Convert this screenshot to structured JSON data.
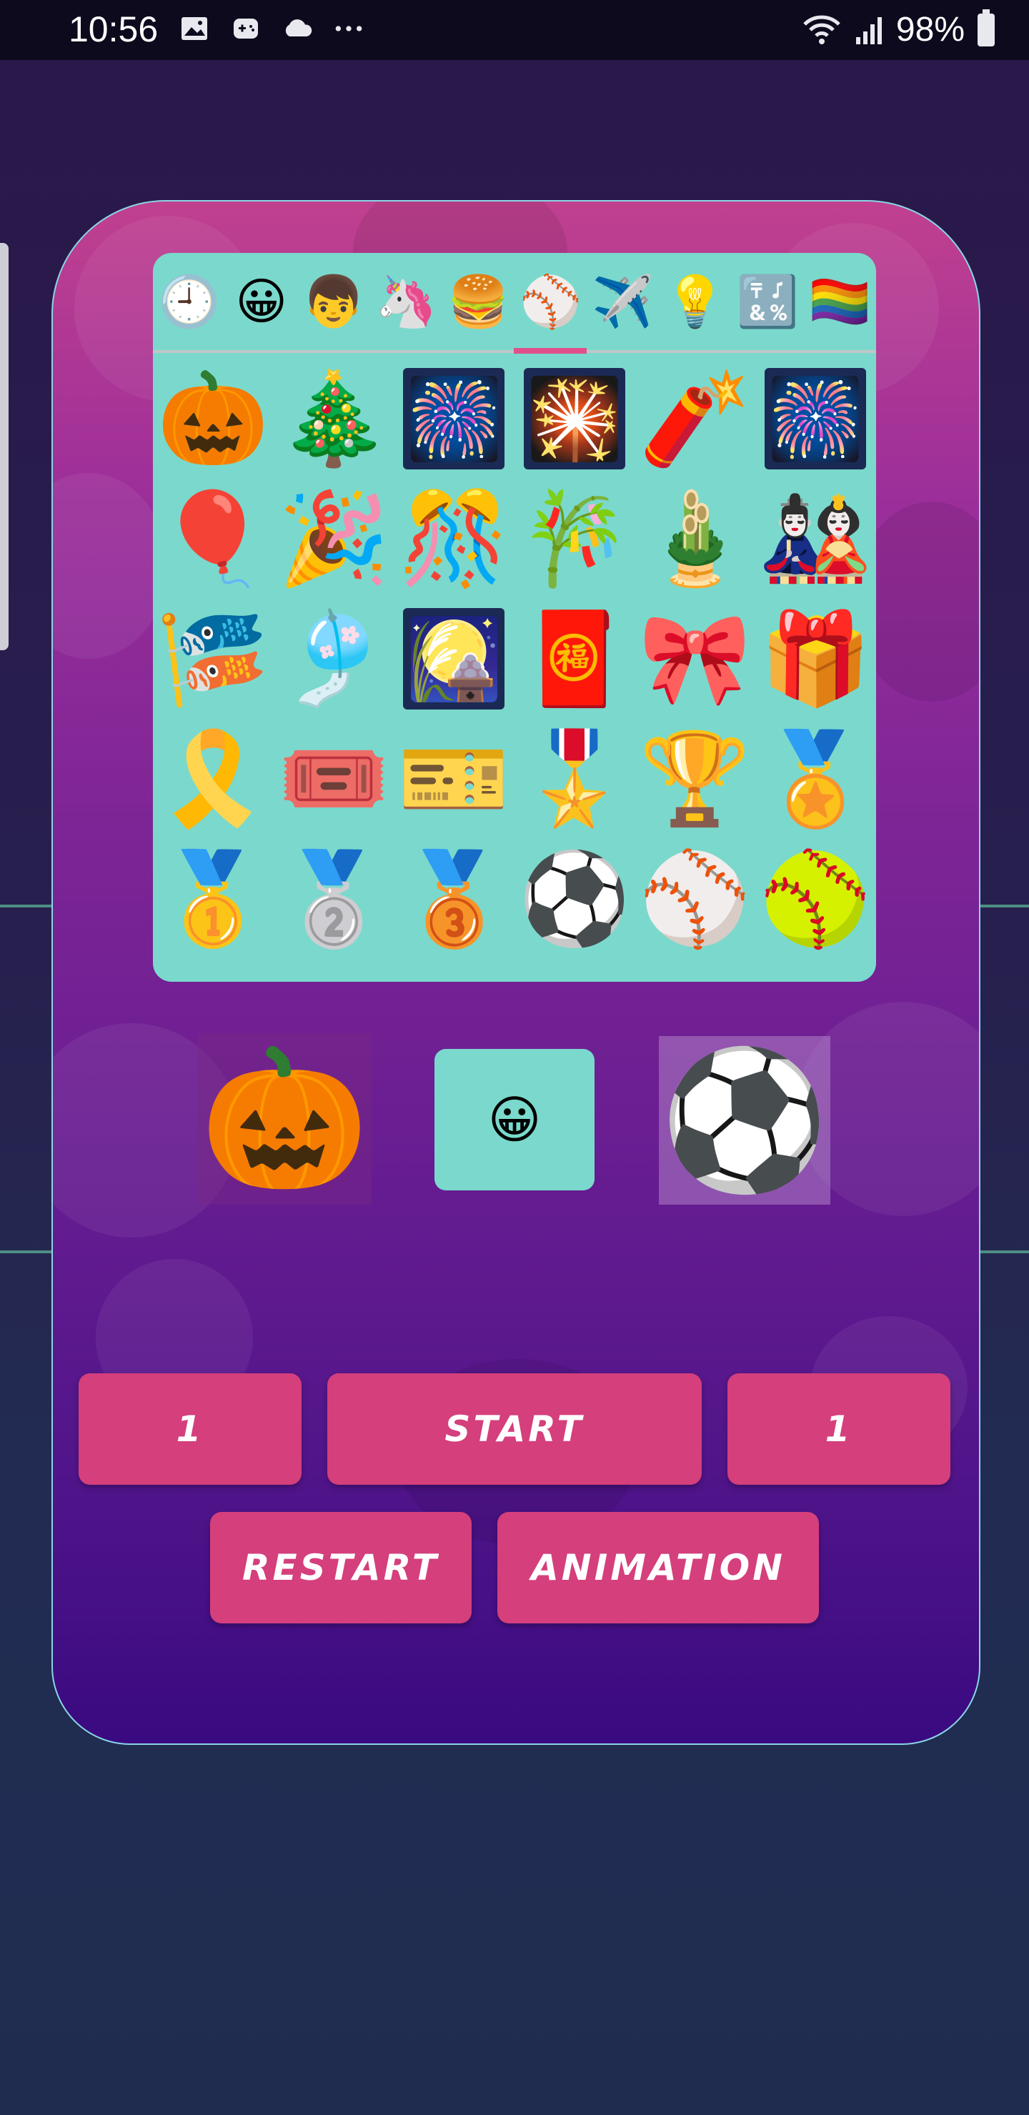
{
  "status_bar": {
    "time": "10:56",
    "battery": "98%",
    "left_icons": [
      "image-icon",
      "game-icon",
      "cloud-icon",
      "more-icon"
    ],
    "right_icons": [
      "wifi-icon",
      "signal-icon",
      "battery-icon"
    ]
  },
  "picker": {
    "categories": [
      "🕘",
      "😀",
      "👦",
      "🦄",
      "🍔",
      "⚾",
      "✈️",
      "💡",
      "🔣",
      "🏳️‍🌈"
    ],
    "selected_category_index": 5,
    "emojis": [
      "🎃",
      "🎄",
      "🎆",
      "🎇",
      "🧨",
      "🎆",
      "🎈",
      "🎉",
      "🎊",
      "🎋",
      "🎍",
      "🎎",
      "🎏",
      "🎐",
      "🎑",
      "🧧",
      "🎀",
      "🎁",
      "🎗️",
      "🎟️",
      "🎫",
      "🎖️",
      "🏆",
      "🏅",
      "🥇",
      "🥈",
      "🥉",
      "⚽",
      "⚾",
      "🥎"
    ]
  },
  "selection": {
    "left": "🎃",
    "middle": "😀",
    "right": "⚽"
  },
  "buttons": {
    "left_count": "1",
    "start": "START",
    "right_count": "1",
    "restart": "RESTART",
    "animation": "ANIMATION"
  },
  "colors": {
    "picker_bg": "#7ad9cc",
    "button_bg": "#d43f7c",
    "tab_indicator": "#e0508c"
  }
}
